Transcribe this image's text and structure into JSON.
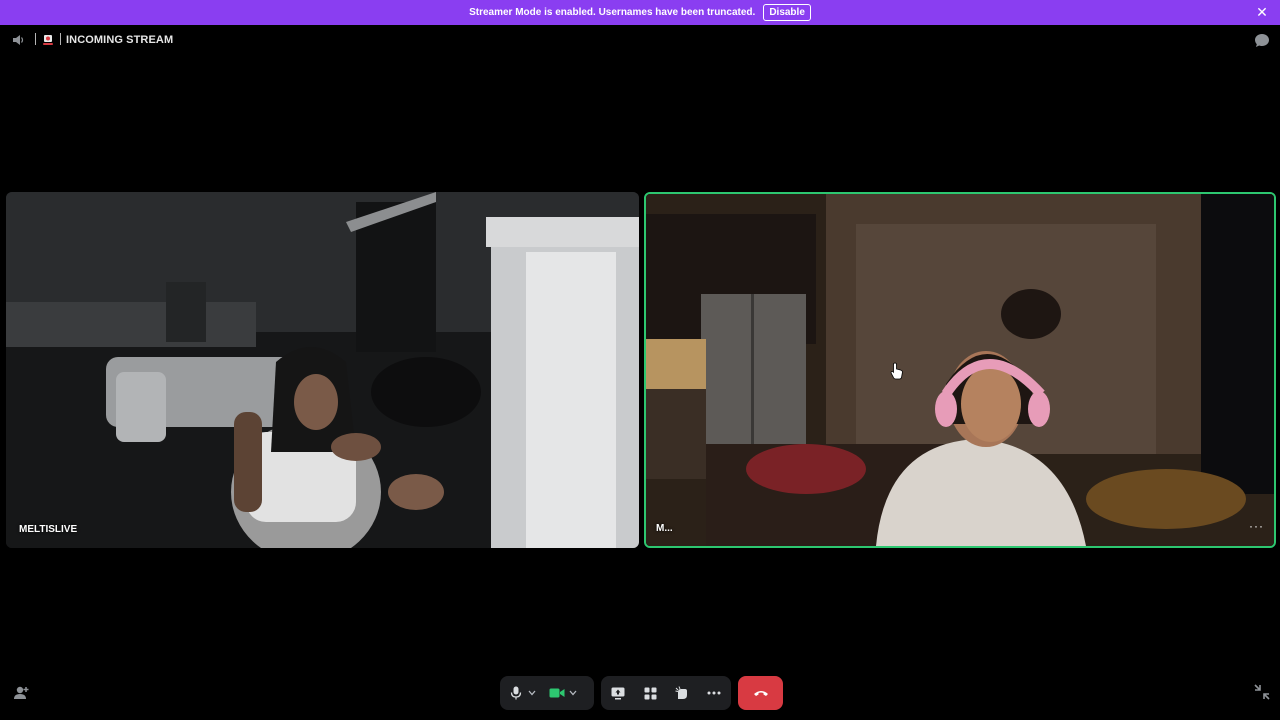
{
  "banner": {
    "message": "Streamer Mode is enabled. Usernames have been truncated.",
    "disable_label": "Disable",
    "close_icon": "close-icon",
    "background": "#8a3ef1"
  },
  "header": {
    "title": "INCOMING STREAM",
    "speaker_icon": "speaker-icon",
    "live_icon": "live-stream-icon",
    "chat_icon": "chat-bubble-icon"
  },
  "tiles": [
    {
      "username": "MELTISLIVE",
      "speaking": false
    },
    {
      "username": "M...",
      "speaking": true,
      "speaking_color": "#2dc770",
      "more_label": "···"
    }
  ],
  "controls": {
    "items": [
      {
        "icon": "microphone-icon",
        "label": "Microphone"
      },
      {
        "icon": "chevron-down-icon",
        "label": "Audio options"
      },
      {
        "icon": "camera-icon",
        "label": "Camera"
      },
      {
        "icon": "chevron-down-icon",
        "label": "Video options"
      },
      {
        "icon": "screen-share-icon",
        "label": "Share screen"
      },
      {
        "icon": "activities-icon",
        "label": "Activities"
      },
      {
        "icon": "soundboard-icon",
        "label": "Soundboard"
      },
      {
        "icon": "more-icon",
        "label": "More options"
      },
      {
        "icon": "hang-up-icon",
        "label": "Disconnect"
      }
    ],
    "hangup_color": "#d83a42",
    "camera_color": "#2dc770"
  }
}
